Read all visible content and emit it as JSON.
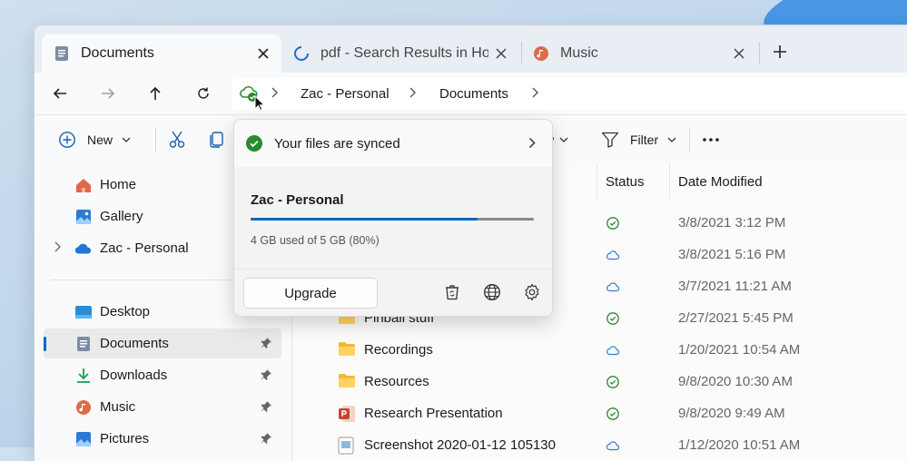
{
  "tabs": [
    {
      "label": "Documents",
      "icon": "document-icon"
    },
    {
      "label": "pdf - Search Results in Hom",
      "icon": "loading-spinner-icon"
    },
    {
      "label": "Music",
      "icon": "music-icon"
    }
  ],
  "breadcrumb": {
    "items": [
      "Zac - Personal",
      "Documents"
    ]
  },
  "toolbar": {
    "new_label": "New",
    "view_fragment": "w",
    "filter_label": "Filter"
  },
  "sidebar": {
    "items": [
      {
        "label": "Home",
        "icon": "home-icon"
      },
      {
        "label": "Gallery",
        "icon": "gallery-icon"
      },
      {
        "label": "Zac - Personal",
        "icon": "onedrive-cloud-icon"
      },
      {
        "label": "Desktop",
        "icon": "desktop-icon"
      },
      {
        "label": "Documents",
        "icon": "document-icon",
        "selected": true
      },
      {
        "label": "Downloads",
        "icon": "download-icon"
      },
      {
        "label": "Music",
        "icon": "music-icon"
      },
      {
        "label": "Pictures",
        "icon": "pictures-icon"
      }
    ]
  },
  "filelist": {
    "columns": {
      "status": "Status",
      "date_modified": "Date Modified"
    },
    "rows": [
      {
        "name": "",
        "status": "synced",
        "date": "3/8/2021 3:12 PM"
      },
      {
        "name": "",
        "status": "cloud",
        "date": "3/8/2021 5:16 PM"
      },
      {
        "name": "",
        "status": "cloud",
        "date": "3/7/2021 11:21 AM"
      },
      {
        "name": "Pinball stuff",
        "type": "folder",
        "status": "synced",
        "date": "2/27/2021 5:45 PM"
      },
      {
        "name": "Recordings",
        "type": "folder",
        "status": "cloud",
        "date": "1/20/2021 10:54 AM"
      },
      {
        "name": "Resources",
        "type": "folder",
        "status": "synced",
        "date": "9/8/2020 10:30 AM"
      },
      {
        "name": "Research Presentation",
        "type": "powerpoint",
        "status": "synced",
        "date": "9/8/2020 9:49 AM"
      },
      {
        "name": "Screenshot 2020-01-12 105130",
        "type": "image",
        "status": "cloud",
        "date": "1/12/2020 10:51 AM"
      }
    ]
  },
  "onedrive_flyout": {
    "sync_status": "Your files are synced",
    "account_name": "Zac - Personal",
    "usage_text": "4 GB used of 5 GB (80%)",
    "usage_fraction": 0.8,
    "upgrade_label": "Upgrade"
  },
  "colors": {
    "accent": "#0067c0",
    "sync_green": "#2a8a2e",
    "cloud_blue": "#2a7fd4"
  }
}
